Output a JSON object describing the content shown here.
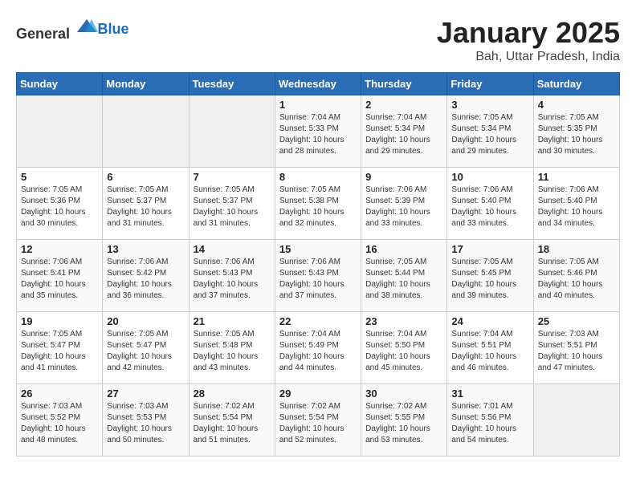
{
  "header": {
    "logo_general": "General",
    "logo_blue": "Blue",
    "month": "January 2025",
    "location": "Bah, Uttar Pradesh, India"
  },
  "weekdays": [
    "Sunday",
    "Monday",
    "Tuesday",
    "Wednesday",
    "Thursday",
    "Friday",
    "Saturday"
  ],
  "weeks": [
    [
      {
        "day": "",
        "info": ""
      },
      {
        "day": "",
        "info": ""
      },
      {
        "day": "",
        "info": ""
      },
      {
        "day": "1",
        "info": "Sunrise: 7:04 AM\nSunset: 5:33 PM\nDaylight: 10 hours\nand 28 minutes."
      },
      {
        "day": "2",
        "info": "Sunrise: 7:04 AM\nSunset: 5:34 PM\nDaylight: 10 hours\nand 29 minutes."
      },
      {
        "day": "3",
        "info": "Sunrise: 7:05 AM\nSunset: 5:34 PM\nDaylight: 10 hours\nand 29 minutes."
      },
      {
        "day": "4",
        "info": "Sunrise: 7:05 AM\nSunset: 5:35 PM\nDaylight: 10 hours\nand 30 minutes."
      }
    ],
    [
      {
        "day": "5",
        "info": "Sunrise: 7:05 AM\nSunset: 5:36 PM\nDaylight: 10 hours\nand 30 minutes."
      },
      {
        "day": "6",
        "info": "Sunrise: 7:05 AM\nSunset: 5:37 PM\nDaylight: 10 hours\nand 31 minutes."
      },
      {
        "day": "7",
        "info": "Sunrise: 7:05 AM\nSunset: 5:37 PM\nDaylight: 10 hours\nand 31 minutes."
      },
      {
        "day": "8",
        "info": "Sunrise: 7:05 AM\nSunset: 5:38 PM\nDaylight: 10 hours\nand 32 minutes."
      },
      {
        "day": "9",
        "info": "Sunrise: 7:06 AM\nSunset: 5:39 PM\nDaylight: 10 hours\nand 33 minutes."
      },
      {
        "day": "10",
        "info": "Sunrise: 7:06 AM\nSunset: 5:40 PM\nDaylight: 10 hours\nand 33 minutes."
      },
      {
        "day": "11",
        "info": "Sunrise: 7:06 AM\nSunset: 5:40 PM\nDaylight: 10 hours\nand 34 minutes."
      }
    ],
    [
      {
        "day": "12",
        "info": "Sunrise: 7:06 AM\nSunset: 5:41 PM\nDaylight: 10 hours\nand 35 minutes."
      },
      {
        "day": "13",
        "info": "Sunrise: 7:06 AM\nSunset: 5:42 PM\nDaylight: 10 hours\nand 36 minutes."
      },
      {
        "day": "14",
        "info": "Sunrise: 7:06 AM\nSunset: 5:43 PM\nDaylight: 10 hours\nand 37 minutes."
      },
      {
        "day": "15",
        "info": "Sunrise: 7:06 AM\nSunset: 5:43 PM\nDaylight: 10 hours\nand 37 minutes."
      },
      {
        "day": "16",
        "info": "Sunrise: 7:05 AM\nSunset: 5:44 PM\nDaylight: 10 hours\nand 38 minutes."
      },
      {
        "day": "17",
        "info": "Sunrise: 7:05 AM\nSunset: 5:45 PM\nDaylight: 10 hours\nand 39 minutes."
      },
      {
        "day": "18",
        "info": "Sunrise: 7:05 AM\nSunset: 5:46 PM\nDaylight: 10 hours\nand 40 minutes."
      }
    ],
    [
      {
        "day": "19",
        "info": "Sunrise: 7:05 AM\nSunset: 5:47 PM\nDaylight: 10 hours\nand 41 minutes."
      },
      {
        "day": "20",
        "info": "Sunrise: 7:05 AM\nSunset: 5:47 PM\nDaylight: 10 hours\nand 42 minutes."
      },
      {
        "day": "21",
        "info": "Sunrise: 7:05 AM\nSunset: 5:48 PM\nDaylight: 10 hours\nand 43 minutes."
      },
      {
        "day": "22",
        "info": "Sunrise: 7:04 AM\nSunset: 5:49 PM\nDaylight: 10 hours\nand 44 minutes."
      },
      {
        "day": "23",
        "info": "Sunrise: 7:04 AM\nSunset: 5:50 PM\nDaylight: 10 hours\nand 45 minutes."
      },
      {
        "day": "24",
        "info": "Sunrise: 7:04 AM\nSunset: 5:51 PM\nDaylight: 10 hours\nand 46 minutes."
      },
      {
        "day": "25",
        "info": "Sunrise: 7:03 AM\nSunset: 5:51 PM\nDaylight: 10 hours\nand 47 minutes."
      }
    ],
    [
      {
        "day": "26",
        "info": "Sunrise: 7:03 AM\nSunset: 5:52 PM\nDaylight: 10 hours\nand 48 minutes."
      },
      {
        "day": "27",
        "info": "Sunrise: 7:03 AM\nSunset: 5:53 PM\nDaylight: 10 hours\nand 50 minutes."
      },
      {
        "day": "28",
        "info": "Sunrise: 7:02 AM\nSunset: 5:54 PM\nDaylight: 10 hours\nand 51 minutes."
      },
      {
        "day": "29",
        "info": "Sunrise: 7:02 AM\nSunset: 5:54 PM\nDaylight: 10 hours\nand 52 minutes."
      },
      {
        "day": "30",
        "info": "Sunrise: 7:02 AM\nSunset: 5:55 PM\nDaylight: 10 hours\nand 53 minutes."
      },
      {
        "day": "31",
        "info": "Sunrise: 7:01 AM\nSunset: 5:56 PM\nDaylight: 10 hours\nand 54 minutes."
      },
      {
        "day": "",
        "info": ""
      }
    ]
  ]
}
